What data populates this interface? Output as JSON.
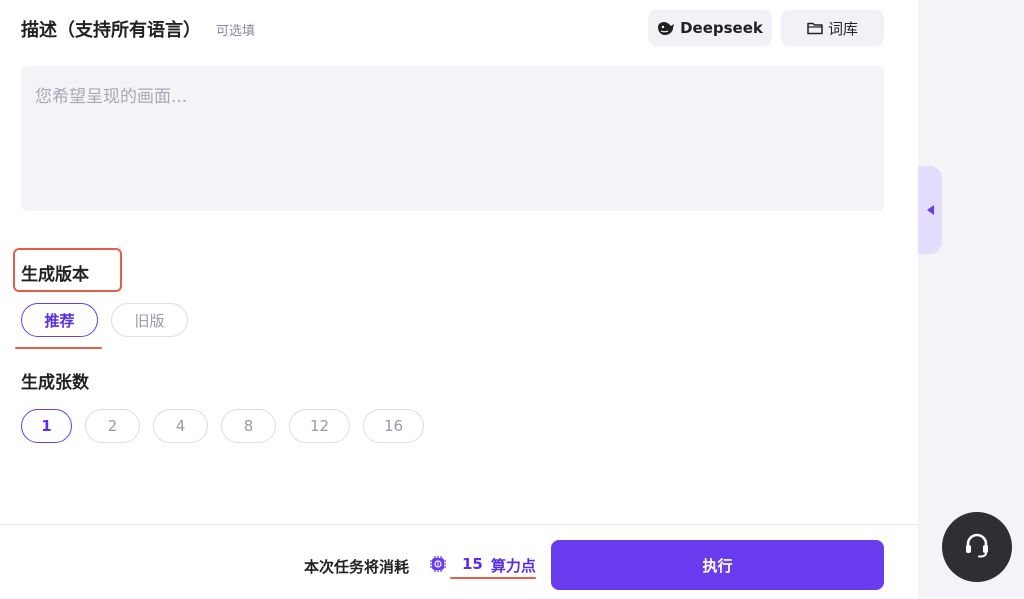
{
  "description": {
    "title": "描述（支持所有语言）",
    "optional": "可选填",
    "placeholder": "您希望呈现的画面..."
  },
  "tools": {
    "deepseek_label": "Deepseek",
    "lexicon_label": "词库"
  },
  "version": {
    "title": "生成版本",
    "options": [
      "推荐",
      "旧版"
    ],
    "selected": "推荐"
  },
  "count": {
    "title": "生成张数",
    "options": [
      "1",
      "2",
      "4",
      "8",
      "12",
      "16"
    ],
    "selected": "1"
  },
  "footer": {
    "cost_label": "本次任务将消耗",
    "cost_amount": "15",
    "cost_unit": "算力点",
    "execute_label": "执行"
  },
  "colors": {
    "accent": "#6a3cf0",
    "annotation": "#e2604b"
  },
  "icons": {
    "deepseek": "whale-icon",
    "lexicon": "folder-icon",
    "cost": "chip-icon",
    "collapse": "caret-left-icon",
    "support": "headset-icon"
  }
}
